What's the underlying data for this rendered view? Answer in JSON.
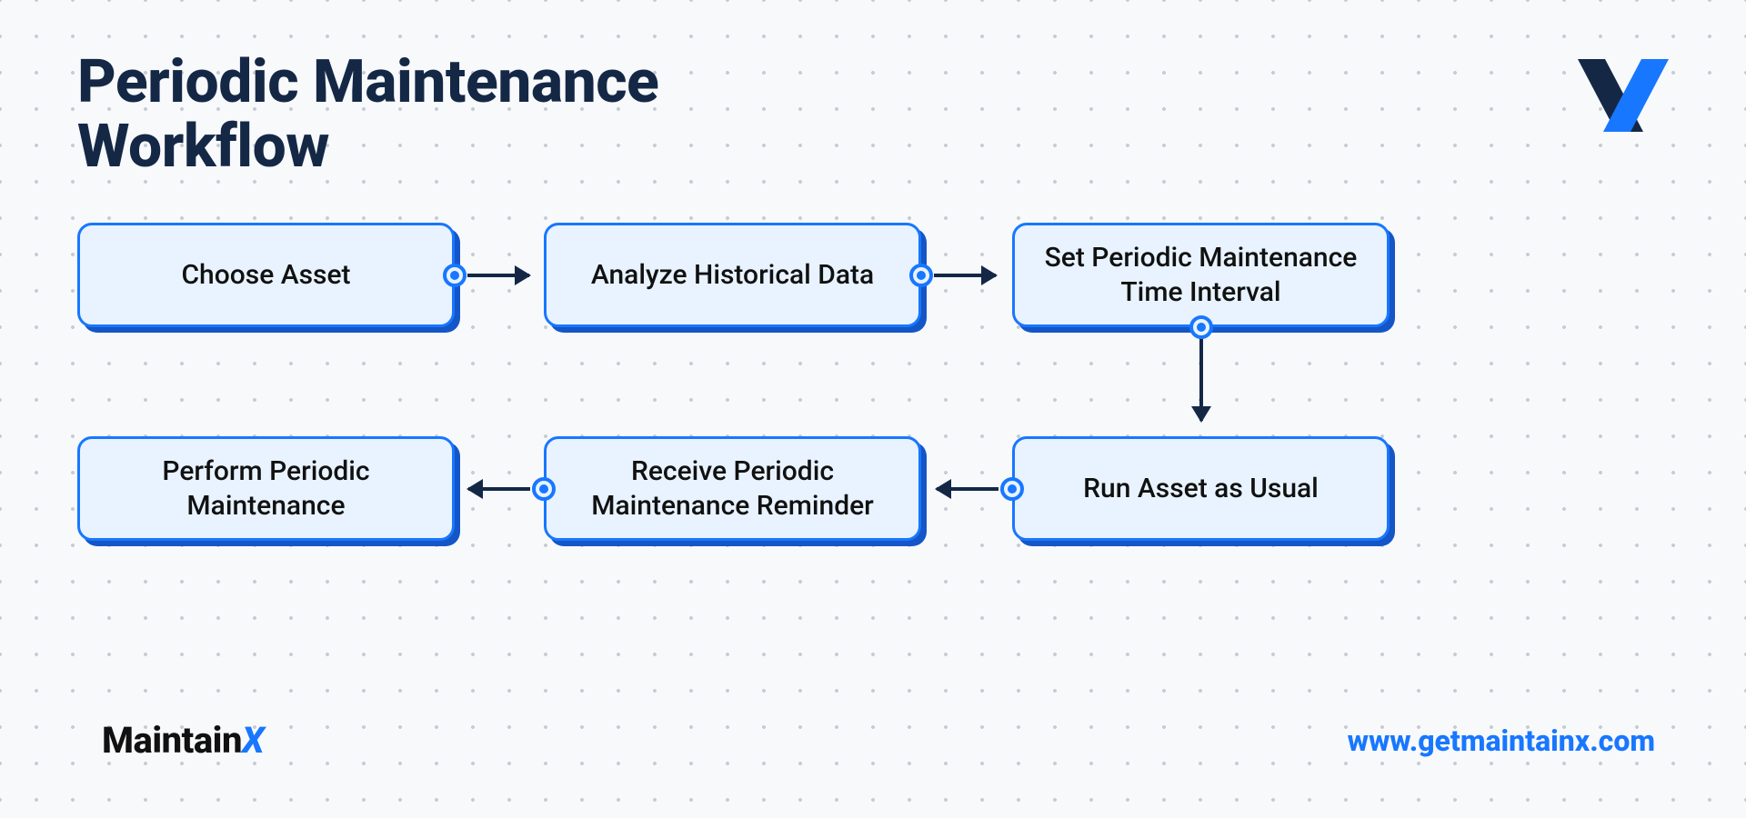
{
  "title": "Periodic Maintenance\nWorkflow",
  "steps": {
    "s1": "Choose Asset",
    "s2": "Analyze Historical Data",
    "s3": "Set Periodic Maintenance\nTime Interval",
    "s4": "Run Asset as Usual",
    "s5": "Receive Periodic\nMaintenance Reminder",
    "s6": "Perform Periodic\nMaintenance"
  },
  "brand": {
    "name": "Maintain",
    "suffix": "X",
    "url": "www.getmaintainx.com"
  },
  "colors": {
    "accent": "#1877ff",
    "dark": "#142846",
    "boxfill": "#e8f3ff"
  }
}
